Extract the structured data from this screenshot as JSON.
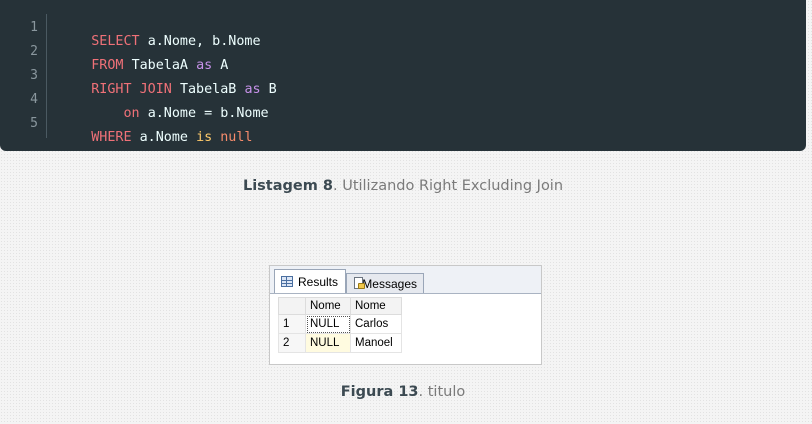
{
  "code": {
    "line_numbers": [
      "1",
      "2",
      "3",
      "4",
      "5"
    ],
    "lines": [
      [
        {
          "t": "SELECT ",
          "c": "kw"
        },
        {
          "t": "a.Nome, b.Nome",
          "c": "id"
        }
      ],
      [
        {
          "t": "FROM ",
          "c": "kw"
        },
        {
          "t": "TabelaA ",
          "c": "id"
        },
        {
          "t": "as ",
          "c": "kw2"
        },
        {
          "t": "A",
          "c": "id"
        }
      ],
      [
        {
          "t": "RIGHT JOIN ",
          "c": "kw"
        },
        {
          "t": "TabelaB ",
          "c": "id"
        },
        {
          "t": "as ",
          "c": "kw2"
        },
        {
          "t": "B",
          "c": "id"
        }
      ],
      [
        {
          "t": "    on ",
          "c": "kw"
        },
        {
          "t": "a.Nome = b.Nome",
          "c": "id"
        }
      ],
      [
        {
          "t": "WHERE ",
          "c": "kw"
        },
        {
          "t": "a.Nome ",
          "c": "id"
        },
        {
          "t": "is ",
          "c": "is"
        },
        {
          "t": "null",
          "c": "nul"
        }
      ]
    ]
  },
  "caption1": {
    "bold": "Listagem 8",
    "rest": ". Utilizando Right Excluding Join"
  },
  "results": {
    "tab_results": "Results",
    "tab_messages": "Messages",
    "headers": [
      "",
      "Nome",
      "Nome"
    ],
    "rows": [
      [
        "1",
        "NULL",
        "Carlos"
      ],
      [
        "2",
        "NULL",
        "Manoel"
      ]
    ]
  },
  "caption2": {
    "bold": "Figura 13",
    "rest": ". titulo"
  }
}
